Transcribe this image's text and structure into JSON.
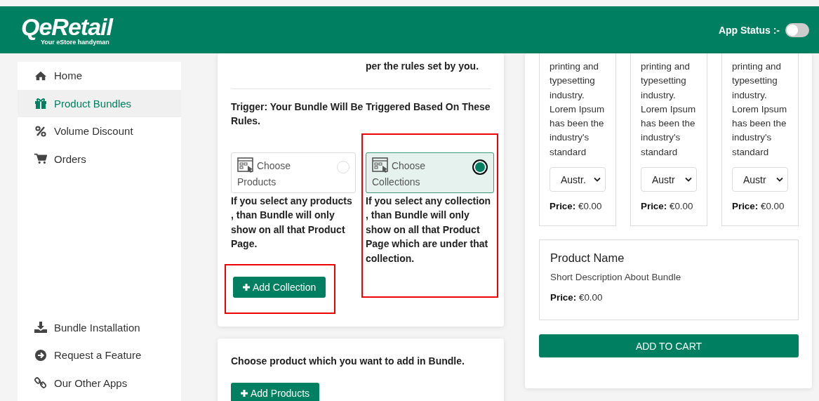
{
  "header": {
    "logo": "QeRetail",
    "tagline": "Your eStore handyman",
    "app_status_label": "App Status :-",
    "app_status_on": false
  },
  "sidebar": {
    "items": [
      {
        "label": "Home",
        "selected": false
      },
      {
        "label": "Product Bundles",
        "selected": true
      },
      {
        "label": "Volume Discount",
        "selected": false
      },
      {
        "label": "Orders",
        "selected": false
      }
    ],
    "footer_items": [
      {
        "label": "Bundle Installation"
      },
      {
        "label": "Request a Feature"
      },
      {
        "label": "Our Other Apps"
      }
    ]
  },
  "display_rules": {
    "right_text_fragment": "per the rules set by you."
  },
  "trigger": {
    "heading": "Trigger: Your Bundle Will Be Triggered Based On These Rules.",
    "options": [
      {
        "label": "Choose Products",
        "selected": false,
        "highlighted": false,
        "description": "If you select any products , than Bundle will only show on all that Product Page."
      },
      {
        "label": "Choose Collections",
        "selected": true,
        "highlighted": true,
        "description": "If you select any collection , than Bundle will only show on all that Product Page which are under that collection."
      }
    ],
    "button": {
      "label": "Add Collection",
      "highlighted": true
    }
  },
  "products_section": {
    "heading": "Choose product which you want to add in Bundle.",
    "button": "Add Products"
  },
  "preview": {
    "cards": [
      {
        "description": "printing and typesetting industry. Lorem Ipsum has been the industry's standard",
        "select_value": "Austr.",
        "price_label": "Price:",
        "price": "€0.00"
      },
      {
        "description": "printing and typesetting industry. Lorem Ipsum has been the industry's standard",
        "select_value": "Austr",
        "price_label": "Price:",
        "price": "€0.00"
      },
      {
        "description": "printing and typesetting industry. Lorem Ipsum has been the industry's standard",
        "select_value": "Austr",
        "price_label": "Price:",
        "price": "€0.00"
      }
    ],
    "summary": {
      "title": "Product Name",
      "description": "Short Description About Bundle",
      "price_label": "Price:",
      "price": "€0.00"
    },
    "button": "ADD TO CART"
  }
}
